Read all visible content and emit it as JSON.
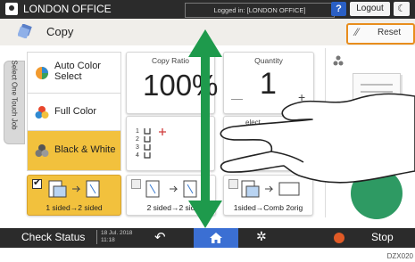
{
  "topbar": {
    "office": "LONDON OFFICE",
    "logged_in": "Logged in: [LONDON OFFICE]",
    "help": "?",
    "logout": "Logout"
  },
  "header": {
    "title": "Copy",
    "reset": "Reset"
  },
  "sidetab": {
    "label": "Select One Touch Job"
  },
  "buttons": {
    "auto_color": "Auto Color Select",
    "full_color": "Full Color",
    "black_white": "Black & White"
  },
  "tiles": {
    "ratio_label": "Copy Ratio",
    "ratio_value": "100%",
    "quantity_label": "Quantity",
    "quantity_value": "1",
    "select_label": "elect"
  },
  "bottom": {
    "b1": "1 sided→2 sided",
    "b2": "2 sided→2 sid",
    "b3": "1sided→Comb 2orig"
  },
  "status": {
    "check": "Check Status",
    "date": "18 Jul. 2018",
    "time": "11:18",
    "stop": "Stop"
  },
  "figure_code": "DZX020"
}
